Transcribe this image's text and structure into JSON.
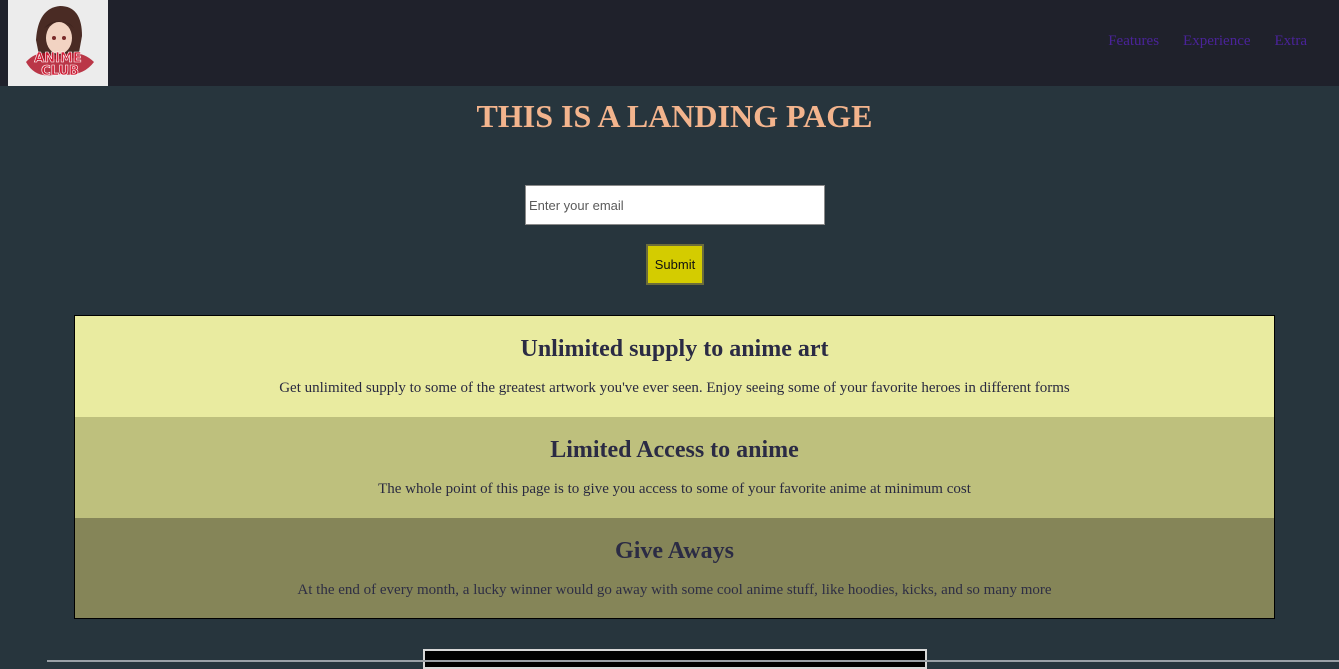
{
  "header": {
    "logo": {
      "text_line1": "ANIME",
      "text_line2": "CLUB"
    },
    "nav": [
      {
        "label": "Features"
      },
      {
        "label": "Experience"
      },
      {
        "label": "Extra"
      }
    ]
  },
  "main": {
    "title": "THIS IS A LANDING PAGE",
    "form": {
      "email_placeholder": "Enter your email",
      "submit_label": "Submit"
    },
    "features": [
      {
        "heading": "Unlimited supply to anime art",
        "text": "Get unlimited supply to some of the greatest artwork you've ever seen. Enjoy seeing some of your favorite heroes in different forms"
      },
      {
        "heading": "Limited Access to anime",
        "text": "The whole point of this page is to give you access to some of your favorite anime at minimum cost"
      },
      {
        "heading": "Give Aways",
        "text": "At the end of every month, a lucky winner would go away with some cool anime stuff, like hoodies, kicks, and so many more"
      }
    ]
  },
  "colors": {
    "header_bg": "#1f212b",
    "page_bg": "#27353d",
    "title": "#f3b48d",
    "nav_link": "#4a2399",
    "submit_bg": "#d4cc00"
  }
}
